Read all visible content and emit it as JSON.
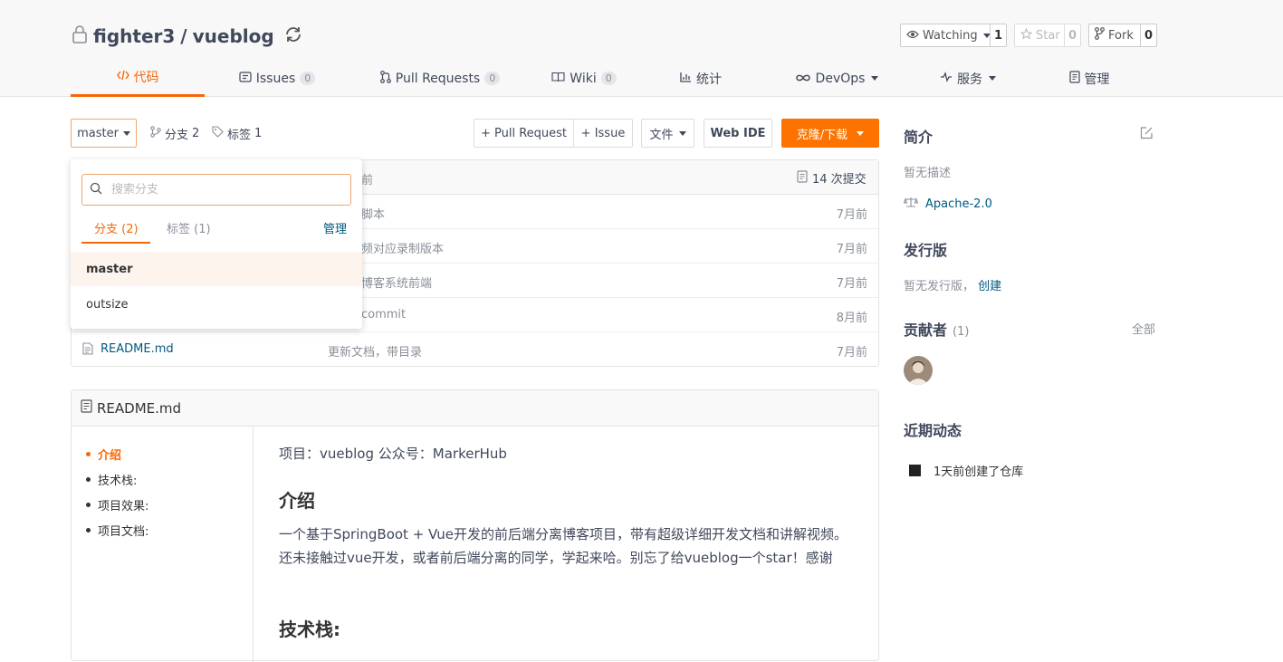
{
  "repo": {
    "owner": "fighter3",
    "separator": "/",
    "name": "vueblog"
  },
  "social": {
    "watch": {
      "label": "Watching",
      "count": "1"
    },
    "star": {
      "label": "Star",
      "count": "0"
    },
    "fork": {
      "label": "Fork",
      "count": "0"
    }
  },
  "tabs": [
    {
      "label": "代码",
      "icon": "code-icon"
    },
    {
      "label": "Issues",
      "badge": "0",
      "icon": "issue-icon"
    },
    {
      "label": "Pull Requests",
      "badge": "0",
      "icon": "pull-request-icon"
    },
    {
      "label": "Wiki",
      "badge": "0",
      "icon": "wiki-icon"
    },
    {
      "label": "统计",
      "icon": "chart-icon"
    },
    {
      "label": "DevOps",
      "icon": "infinity-icon"
    },
    {
      "label": "服务",
      "icon": "pulse-icon"
    },
    {
      "label": "管理",
      "icon": "manage-icon"
    }
  ],
  "toolbar": {
    "branch": "master",
    "branches_label": "分支",
    "branches_count": "2",
    "tags_label": "标签",
    "tags_count": "1",
    "pull_request": "+ Pull Request",
    "issue": "+ Issue",
    "files": "文件",
    "web_ide": "Web IDE",
    "clone": "克隆/下载"
  },
  "files": {
    "header_time": "前",
    "commits": "14 次提交",
    "rows": [
      {
        "name": "",
        "message": "脚本",
        "time": "7月前"
      },
      {
        "name": "",
        "message": "频对应录制版本",
        "time": "7月前"
      },
      {
        "name": "",
        "message": "博客系统前端",
        "time": "7月前"
      },
      {
        "name": "",
        "message": "commit",
        "time": "8月前"
      },
      {
        "name": "README.md",
        "message": "更新文档，带目录",
        "time": "7月前"
      }
    ]
  },
  "branch_dropdown": {
    "placeholder": "搜索分支",
    "tab_branches": "分支 (2)",
    "tab_tags": "标签 (1)",
    "manage": "管理",
    "items": [
      "master",
      "outsize"
    ]
  },
  "readme": {
    "title": "README.md",
    "toc": [
      "介绍",
      "技术栈:",
      "项目效果:",
      "项目文档:"
    ],
    "intro_line": "项目：vueblog 公众号：MarkerHub",
    "h_intro": "介绍",
    "paragraph": "一个基于SpringBoot + Vue开发的前后端分离博客项目，带有超级详细开发文档和讲解视频。还未接触过vue开发，或者前后端分离的同学，学起来哈。别忘了给vueblog一个star！感谢",
    "h_stack": "技术栈:"
  },
  "sidebar": {
    "intro_title": "简介",
    "intro_text": "暂无描述",
    "license": "Apache-2.0",
    "release_title": "发行版",
    "release_text": "暂无发行版，",
    "release_link": "创建",
    "contrib_title": "贡献者",
    "contrib_count": "(1)",
    "contrib_all": "全部",
    "activity_title": "近期动态",
    "activity_text": "1天前创建了仓库"
  },
  "colors": {
    "accent": "#fe7300",
    "link": "#005980",
    "text": "#40485b"
  }
}
